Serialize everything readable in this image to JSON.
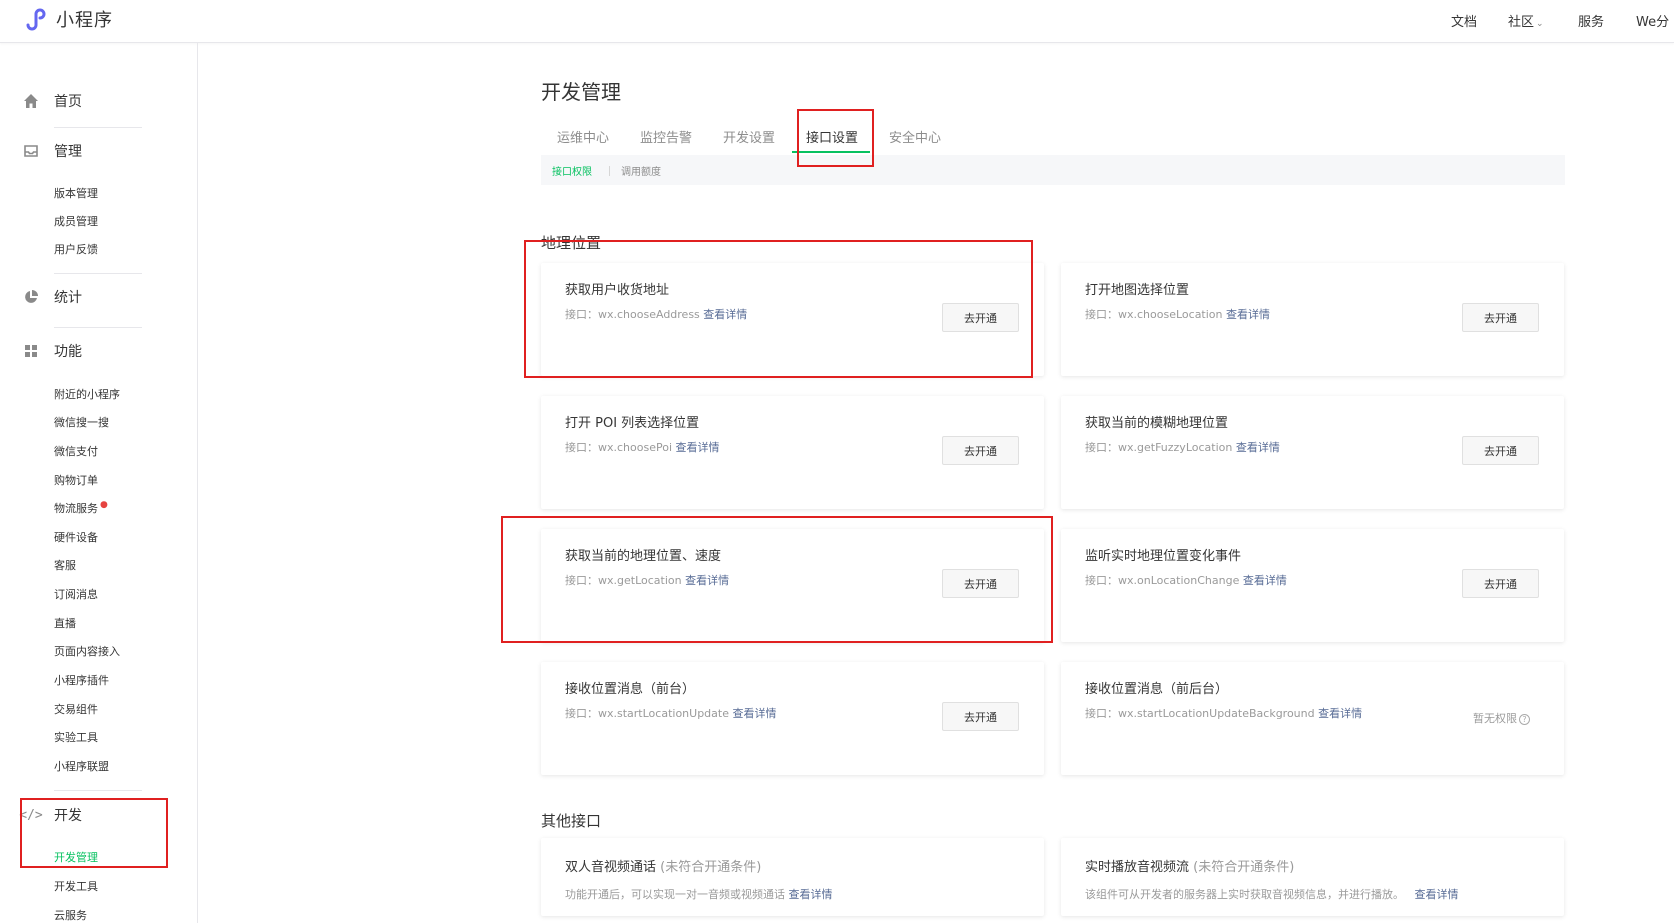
{
  "header": {
    "logo_text": "小程序",
    "nav": {
      "docs": "文档",
      "community": "社区",
      "service": "服务",
      "wepay": "We分"
    }
  },
  "sidebar": {
    "home": "首页",
    "manage": "管理",
    "manage_items": [
      "版本管理",
      "成员管理",
      "用户反馈"
    ],
    "stats": "统计",
    "features": "功能",
    "feature_items": [
      "附近的小程序",
      "微信搜一搜",
      "微信支付",
      "购物订单",
      "物流服务",
      "硬件设备",
      "客服",
      "订阅消息",
      "直播",
      "页面内容接入",
      "小程序插件",
      "交易组件",
      "实验工具",
      "小程序联盟"
    ],
    "dev": "开发",
    "dev_items": [
      "开发管理",
      "开发工具",
      "云服务"
    ]
  },
  "main": {
    "title": "开发管理",
    "tabs": [
      "运维中心",
      "监控告警",
      "开发设置",
      "接口设置",
      "安全中心"
    ],
    "subtabs": [
      "接口权限",
      "调用额度"
    ],
    "section_location": "地理位置",
    "section_other": "其他接口",
    "api_prefix": "接口：",
    "detail_link": "查看详情",
    "open_btn": "去开通",
    "no_permission": "暂无权限",
    "cards": [
      {
        "title": "获取用户收货地址",
        "api": "wx.chooseAddress"
      },
      {
        "title": "打开地图选择位置",
        "api": "wx.chooseLocation"
      },
      {
        "title": "打开 POI 列表选择位置",
        "api": "wx.choosePoi"
      },
      {
        "title": "获取当前的模糊地理位置",
        "api": "wx.getFuzzyLocation"
      },
      {
        "title": "获取当前的地理位置、速度",
        "api": "wx.getLocation"
      },
      {
        "title": "监听实时地理位置变化事件",
        "api": "wx.onLocationChange"
      },
      {
        "title": "接收位置消息（前台）",
        "api": "wx.startLocationUpdate"
      },
      {
        "title": "接收位置消息（前后台）",
        "api": "wx.startLocationUpdateBackground"
      }
    ],
    "other_cards": [
      {
        "title": "双人音视频通话",
        "note": "(未符合开通条件)",
        "desc": "功能开通后，可以实现一对一音频或视频通话"
      },
      {
        "title": "实时播放音视频流",
        "note": "(未符合开通条件)",
        "desc": "该组件可从开发者的服务器上实时获取音视频信息，并进行播放。"
      }
    ]
  }
}
